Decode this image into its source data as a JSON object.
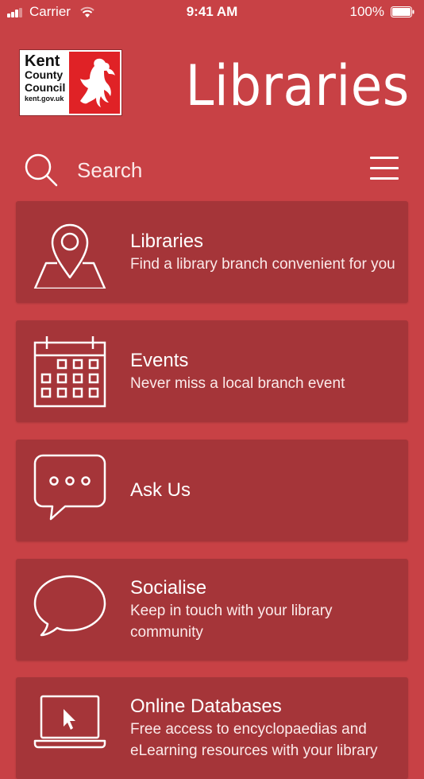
{
  "status_bar": {
    "carrier": "Carrier",
    "time": "9:41 AM",
    "battery": "100%"
  },
  "header": {
    "logo": {
      "line1": "Kent",
      "line2": "County",
      "line3": "Council",
      "line4": "kent.gov.uk"
    },
    "title": "Libraries"
  },
  "search": {
    "label": "Search"
  },
  "cards": [
    {
      "icon": "map-pin-icon",
      "title": "Libraries",
      "description": "Find a library branch convenient for you"
    },
    {
      "icon": "calendar-icon",
      "title": "Events",
      "description": "Never miss a local branch event"
    },
    {
      "icon": "chat-bubble-icon",
      "title": "Ask Us",
      "description": ""
    },
    {
      "icon": "speech-bubble-icon",
      "title": "Socialise",
      "description": "Keep in touch with your library community"
    },
    {
      "icon": "laptop-icon",
      "title": "Online Databases",
      "description": "Free access to encyclopaedias and eLearning resources with your library"
    }
  ],
  "colors": {
    "background": "#c84145",
    "card": "#a53539",
    "logo_red": "#e02226"
  }
}
